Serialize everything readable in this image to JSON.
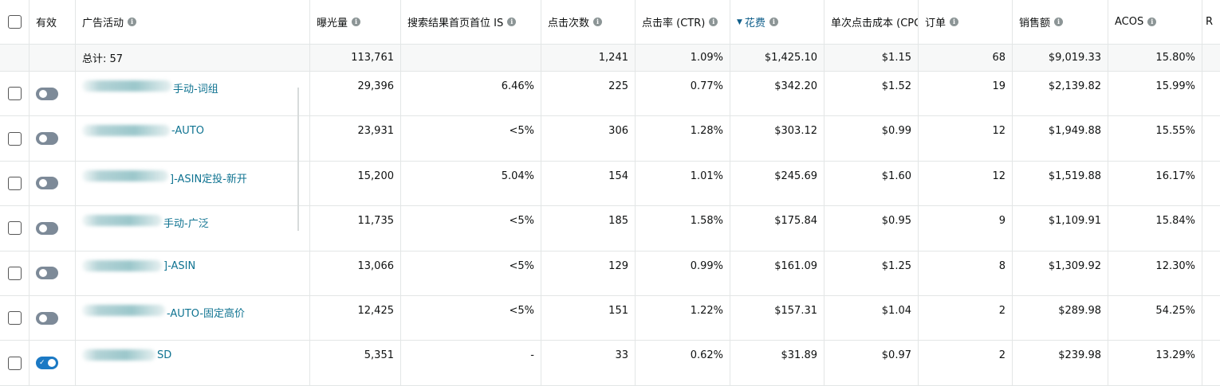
{
  "headers": {
    "enabled": "有效",
    "campaign": "广告活动",
    "impressions": "曝光量",
    "top_of_search_is": "搜索结果首页首位 IS",
    "clicks": "点击次数",
    "ctr": "点击率 (CTR)",
    "spend": "花费",
    "cpc": "单次点击成本 (CPC",
    "orders": "订单",
    "sales": "销售额",
    "acos": "ACOS",
    "extra": "R"
  },
  "sort": {
    "column": "spend",
    "direction": "descending",
    "arrow": "▼"
  },
  "totals": {
    "label": "总计: 57",
    "impressions": "113,761",
    "top_of_search_is": "",
    "clicks": "1,241",
    "ctr": "1.09%",
    "spend": "$1,425.10",
    "cpc": "$1.15",
    "orders": "68",
    "sales": "$9,019.33",
    "acos": "15.80%"
  },
  "rows": [
    {
      "enabled": false,
      "name_suffix": "手动-词组",
      "impressions": "29,396",
      "top_of_search_is": "6.46%",
      "clicks": "225",
      "ctr": "0.77%",
      "spend": "$342.20",
      "cpc": "$1.52",
      "orders": "19",
      "sales": "$2,139.82",
      "acos": "15.99%"
    },
    {
      "enabled": false,
      "name_suffix": "-AUTO",
      "impressions": "23,931",
      "top_of_search_is": "<5%",
      "clicks": "306",
      "ctr": "1.28%",
      "spend": "$303.12",
      "cpc": "$0.99",
      "orders": "12",
      "sales": "$1,949.88",
      "acos": "15.55%"
    },
    {
      "enabled": false,
      "name_suffix": "]-ASIN定投-新开",
      "impressions": "15,200",
      "top_of_search_is": "5.04%",
      "clicks": "154",
      "ctr": "1.01%",
      "spend": "$245.69",
      "cpc": "$1.60",
      "orders": "12",
      "sales": "$1,519.88",
      "acos": "16.17%"
    },
    {
      "enabled": false,
      "name_suffix": "手动-广泛",
      "impressions": "11,735",
      "top_of_search_is": "<5%",
      "clicks": "185",
      "ctr": "1.58%",
      "spend": "$175.84",
      "cpc": "$0.95",
      "orders": "9",
      "sales": "$1,109.91",
      "acos": "15.84%"
    },
    {
      "enabled": false,
      "name_suffix": "]-ASIN",
      "impressions": "13,066",
      "top_of_search_is": "<5%",
      "clicks": "129",
      "ctr": "0.99%",
      "spend": "$161.09",
      "cpc": "$1.25",
      "orders": "8",
      "sales": "$1,309.92",
      "acos": "12.30%"
    },
    {
      "enabled": false,
      "name_suffix": "-AUTO-固定高价",
      "impressions": "12,425",
      "top_of_search_is": "<5%",
      "clicks": "151",
      "ctr": "1.22%",
      "spend": "$157.31",
      "cpc": "$1.04",
      "orders": "2",
      "sales": "$289.98",
      "acos": "54.25%"
    },
    {
      "enabled": true,
      "name_suffix": "SD",
      "impressions": "5,351",
      "top_of_search_is": "-",
      "clicks": "33",
      "ctr": "0.62%",
      "spend": "$31.89",
      "cpc": "$0.97",
      "orders": "2",
      "sales": "$239.98",
      "acos": "13.29%"
    }
  ],
  "colors": {
    "link": "#0f7391",
    "toggle_on": "#1b79c4",
    "toggle_off": "#7d8a98",
    "sorted_header": "#0f5e8a"
  },
  "icons": {
    "info": "info-circle-icon",
    "toggle_on_check": "check-icon"
  }
}
